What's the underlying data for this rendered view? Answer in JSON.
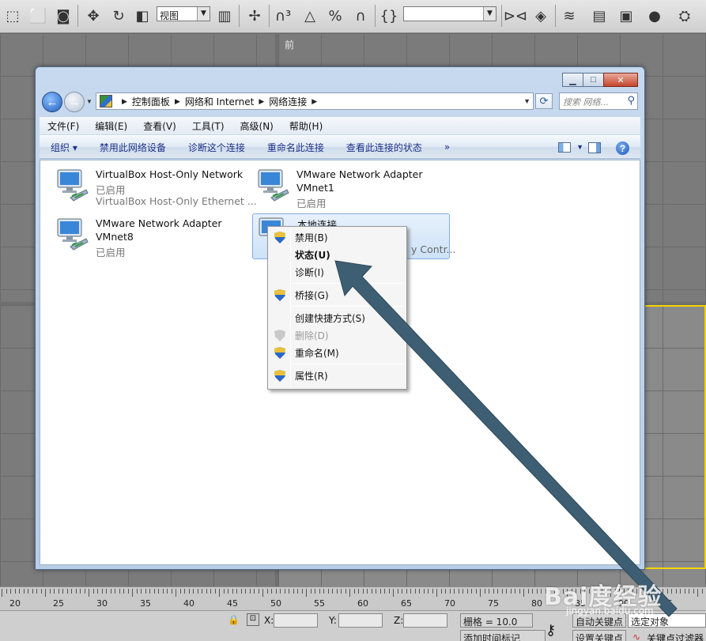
{
  "max_toolbar": {
    "view_combo": "视图",
    "combo2": ""
  },
  "viewport": {
    "front_label": "前"
  },
  "timeline": {
    "ticks": [
      "20",
      "25",
      "30",
      "35",
      "40",
      "45",
      "50",
      "55",
      "60",
      "65",
      "70",
      "75",
      "80",
      "85",
      "90",
      "95"
    ]
  },
  "statusbar": {
    "x_label": "X:",
    "y_label": "Y:",
    "z_label": "Z:",
    "grid": "栅格 = 10.0",
    "auto_key": "自动关键点",
    "selected": "选定对象",
    "set_key": "设置关键点",
    "key_filter": "关键点过滤器",
    "add_time_tag": "添加时间标记"
  },
  "window": {
    "address": {
      "crumbs": [
        "控制面板",
        "网络和 Internet",
        "网络连接"
      ]
    },
    "search_placeholder": "搜索 网络...",
    "menu": [
      "文件(F)",
      "编辑(E)",
      "查看(V)",
      "工具(T)",
      "高级(N)",
      "帮助(H)"
    ],
    "commands": [
      "组织 ▾",
      "禁用此网络设备",
      "诊断这个连接",
      "重命名此连接",
      "查看此连接的状态",
      "»"
    ]
  },
  "connections": [
    {
      "name": "VirtualBox Host-Only Network",
      "status": "已启用",
      "device": "VirtualBox Host-Only Ethernet ..."
    },
    {
      "name": "VMware Network Adapter",
      "status": "VMnet1",
      "device": "已启用"
    },
    {
      "name": "VMware Network Adapter",
      "status": "VMnet8",
      "device": "已启用"
    },
    {
      "name": "本地连接",
      "status": "",
      "device": "y Contr..."
    }
  ],
  "context_menu": {
    "items": [
      {
        "label": "禁用(B)",
        "shield": true
      },
      {
        "label": "状态(U)",
        "shield": false,
        "bold": true
      },
      {
        "label": "诊断(I)",
        "shield": false
      },
      {
        "label": "桥接(G)",
        "shield": true
      },
      {
        "label": "创建快捷方式(S)",
        "shield": false
      },
      {
        "label": "删除(D)",
        "shield": true,
        "disabled": true
      },
      {
        "label": "重命名(M)",
        "shield": true
      },
      {
        "label": "属性(R)",
        "shield": true
      }
    ]
  },
  "watermark": {
    "logo": "Bai度经验",
    "url": "jingyan.baidu.com"
  },
  "colors": {
    "arrow": "#3e5f73",
    "selection": "#cde2f8",
    "window_frame": "#b8cde6"
  }
}
